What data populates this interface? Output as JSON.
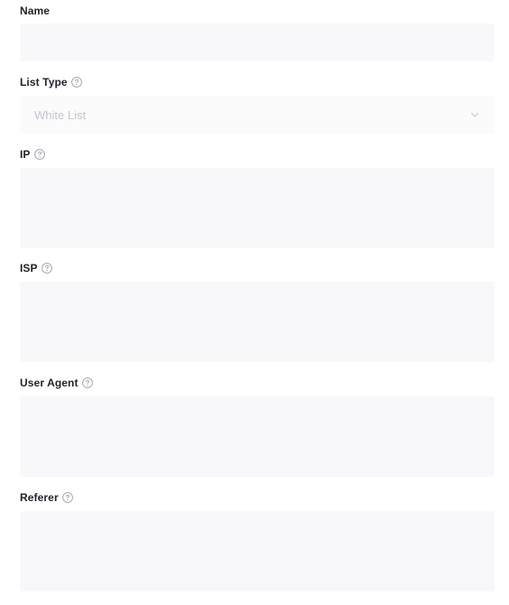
{
  "form": {
    "name": {
      "label": "Name",
      "value": ""
    },
    "list_type": {
      "label": "List Type",
      "selected": "White List"
    },
    "ip": {
      "label": "IP",
      "value": ""
    },
    "isp": {
      "label": "ISP",
      "value": ""
    },
    "user_agent": {
      "label": "User Agent",
      "value": ""
    },
    "referer": {
      "label": "Referer",
      "value": ""
    }
  },
  "icons": {
    "help": "question-circle-icon",
    "dropdown": "chevron-down-icon"
  },
  "colors": {
    "field_background": "#f8f8fa",
    "label_text": "#1f2329",
    "placeholder_text": "#c2c5cc",
    "icon": "#9aa0a8"
  }
}
